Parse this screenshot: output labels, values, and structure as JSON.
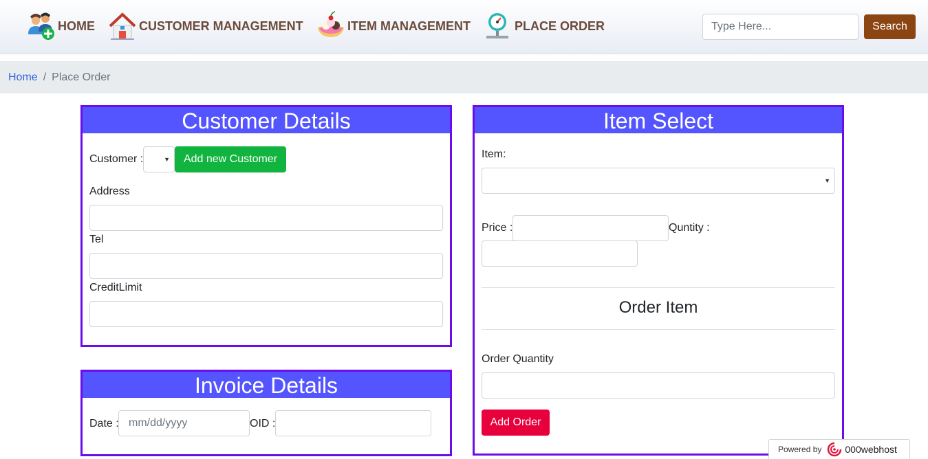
{
  "nav": {
    "items": [
      {
        "label": "HOME",
        "icon": "users-add-icon"
      },
      {
        "label": "CUSTOMER MANAGEMENT",
        "icon": "house-icon"
      },
      {
        "label": "ITEM MANAGEMENT",
        "icon": "dessert-icon"
      },
      {
        "label": "PLACE ORDER",
        "icon": "gauge-icon"
      }
    ],
    "search_placeholder": "Type Here...",
    "search_button": "Search"
  },
  "breadcrumb": {
    "home": "Home",
    "separator": "/",
    "current": "Place Order"
  },
  "customer": {
    "title": "Customer Details",
    "customer_label": "Customer :",
    "add_button": "Add new Customer",
    "address_label": "Address",
    "tel_label": "Tel",
    "credit_label": "CreditLimit"
  },
  "invoice": {
    "title": "Invoice Details",
    "date_label": "Date :",
    "date_placeholder": "mm/dd/yyyy",
    "oid_label": "OID :"
  },
  "item": {
    "title": "Item Select",
    "item_label": "Item:",
    "price_label": "Price :",
    "qty_label": "Quntity :",
    "order_item_heading": "Order Item",
    "order_qty_label": "Order Quantity",
    "add_order_button": "Add Order"
  },
  "footer": {
    "powered_by": "Powered by",
    "brand": "000webhost"
  },
  "colors": {
    "panel_header": "#5555ff",
    "panel_border": "#6a0dea",
    "search_button": "#8b4513",
    "add_customer": "#12b440",
    "add_order": "#e8003d"
  }
}
